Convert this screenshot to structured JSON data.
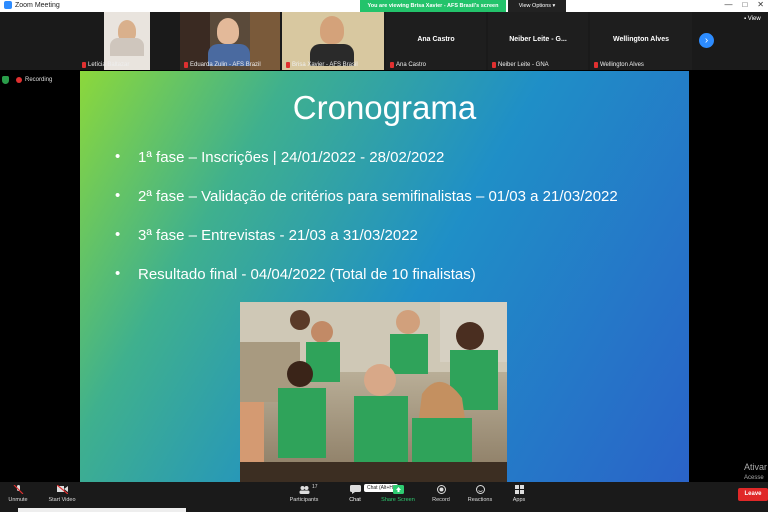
{
  "window": {
    "title": "Zoom Meeting",
    "controls": [
      "—",
      "□",
      "✕"
    ]
  },
  "banner": {
    "viewing": "You are viewing Brisa Xavier - AFS Brasil's screen",
    "view_options": "View Options ▾"
  },
  "participants_strip": [
    {
      "name": "Letícia Baltazar",
      "video": true
    },
    {
      "name": "Eduarda Zulin - AFS Brazil",
      "video": true
    },
    {
      "name": "Brisa Xavier - AFS Brasil",
      "video": true
    },
    {
      "name": "Ana Castro",
      "display": "Ana Castro",
      "video": false
    },
    {
      "name": "Neiber Leite - GNA",
      "display": "Neiber Leite - G...",
      "video": false
    },
    {
      "name": "Wellington Alves",
      "display": "Wellington Alves",
      "video": false
    }
  ],
  "view_label": "▪ View",
  "recording_label": "Recording",
  "slide": {
    "title": "Cronograma",
    "bullets": [
      "1ª fase – Inscrições | 24/01/2022 - 28/02/2022",
      "2ª fase – Validação de critérios para semifinalistas – 01/03 a 21/03/2022",
      "3ª fase – Entrevistas - 21/03 a 31/03/2022",
      "Resultado final - 04/04/2022 (Total de 10 finalistas)"
    ]
  },
  "watermark": {
    "line1": "Ativar",
    "line2": "Acesse"
  },
  "toolbar": {
    "unmute": "Unmute",
    "start_video": "Start Video",
    "participants": "Participants",
    "participants_count": "17",
    "chat": "Chat",
    "chat_tooltip": "Chat (Alt+H)",
    "share_screen": "Share Screen",
    "record": "Record",
    "reactions": "Reactions",
    "apps": "Apps",
    "leave": "Leave"
  },
  "colors": {
    "accent": "#2d8cff",
    "leave": "#e02828",
    "share": "#2ecc71",
    "recording": "#e03030"
  }
}
